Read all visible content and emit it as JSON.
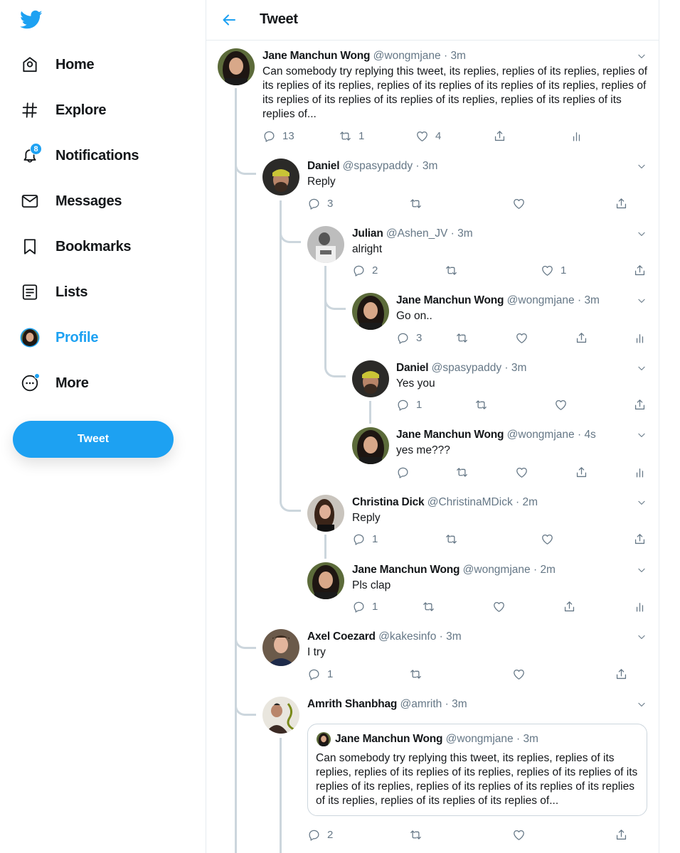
{
  "sidebar": {
    "logo": "twitter-bird-icon",
    "nav": [
      {
        "label": "Home",
        "icon": "home-icon"
      },
      {
        "label": "Explore",
        "icon": "hashtag-icon"
      },
      {
        "label": "Notifications",
        "icon": "bell-icon",
        "badge": "8"
      },
      {
        "label": "Messages",
        "icon": "envelope-icon"
      },
      {
        "label": "Bookmarks",
        "icon": "bookmark-icon"
      },
      {
        "label": "Lists",
        "icon": "list-icon"
      },
      {
        "label": "Profile",
        "icon": "avatar",
        "active": true
      },
      {
        "label": "More",
        "icon": "more-icon"
      }
    ],
    "tweet_button": "Tweet"
  },
  "header": {
    "title": "Tweet",
    "back_icon": "arrow-left-icon"
  },
  "colors": {
    "accent": "#1da1f2",
    "text": "#14171a",
    "secondary": "#657786",
    "thread_line": "#ccd6dd",
    "border": "#e6ecf0"
  },
  "tweets": [
    {
      "name": "Jane Manchun Wong",
      "handle": "@wongmjane",
      "time": "3m",
      "text": "Can somebody try replying this tweet, its replies, replies of its replies, replies of its replies of its replies, replies of its replies of its replies of its replies, replies of its replies of its replies of its replies of its replies, replies of its replies of its replies of...",
      "replies": "13",
      "retweets": "1",
      "likes": "4",
      "analytics": true
    },
    {
      "name": "Daniel",
      "handle": "@spasypaddy",
      "time": "3m",
      "text": "Reply",
      "replies": "3",
      "retweets": "",
      "likes": "",
      "analytics": false
    },
    {
      "name": "Julian",
      "handle": "@Ashen_JV",
      "time": "3m",
      "text": "alright",
      "replies": "2",
      "retweets": "",
      "likes": "1",
      "analytics": false
    },
    {
      "name": "Jane Manchun Wong",
      "handle": "@wongmjane",
      "time": "3m",
      "text": "Go on..",
      "replies": "3",
      "retweets": "",
      "likes": "",
      "analytics": true
    },
    {
      "name": "Daniel",
      "handle": "@spasypaddy",
      "time": "3m",
      "text": "Yes you",
      "replies": "1",
      "retweets": "",
      "likes": "",
      "analytics": false
    },
    {
      "name": "Jane Manchun Wong",
      "handle": "@wongmjane",
      "time": "4s",
      "text": "yes me???",
      "replies": "",
      "retweets": "",
      "likes": "",
      "analytics": true
    },
    {
      "name": "Christina Dick",
      "handle": "@ChristinaMDick",
      "time": "2m",
      "text": "Reply",
      "replies": "1",
      "retweets": "",
      "likes": "",
      "analytics": false
    },
    {
      "name": "Jane Manchun Wong",
      "handle": "@wongmjane",
      "time": "2m",
      "text": "Pls clap",
      "replies": "1",
      "retweets": "",
      "likes": "",
      "analytics": true
    },
    {
      "name": "Axel Coezard",
      "handle": "@kakesinfo",
      "time": "3m",
      "text": "I try",
      "replies": "1",
      "retweets": "",
      "likes": "",
      "analytics": false
    },
    {
      "name": "Amrith Shanbhag",
      "handle": "@amrith",
      "time": "3m",
      "text": "",
      "replies": "2",
      "retweets": "",
      "likes": "",
      "analytics": false
    }
  ],
  "quoted_tweet": {
    "name": "Jane Manchun Wong",
    "handle": "@wongmjane",
    "time": "3m",
    "text": "Can somebody try replying this tweet, its replies, replies of its replies, replies of its replies of its replies, replies of its replies of its replies of its replies, replies of its replies of its replies of its replies of its replies, replies of its replies of its replies of..."
  }
}
